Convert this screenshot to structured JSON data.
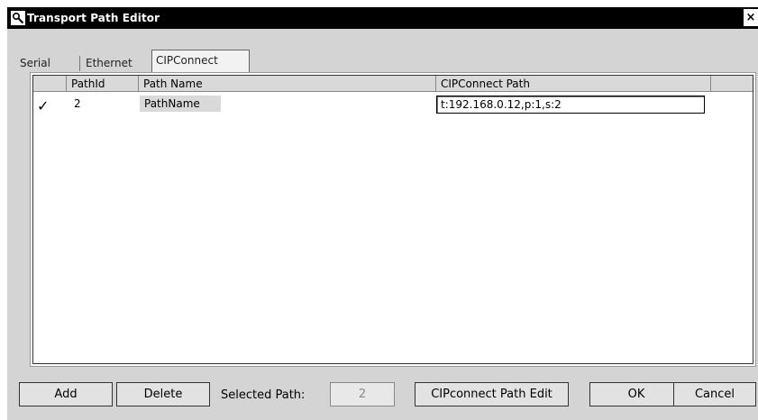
{
  "window": {
    "title": "Transport Path Editor",
    "close_glyph": "×"
  },
  "tabs": [
    {
      "label": "Serial"
    },
    {
      "label": "Ethernet"
    },
    {
      "label": "CIPConnect"
    }
  ],
  "grid": {
    "columns": [
      "",
      "PathId",
      "Path Name",
      "CIPConnect Path"
    ],
    "rows": [
      {
        "checked": "✓",
        "path_id": "2",
        "path_name": "PathName",
        "cip_path": "t:192.168.0.12,p:1,s:2"
      }
    ]
  },
  "footer": {
    "add_label": "Add",
    "delete_label": "Delete",
    "selected_path_label": "Selected Path:",
    "selected_path_value": "2",
    "cip_edit_label": "CIPconnect Path Edit",
    "ok_label": "OK",
    "cancel_label": "Cancel"
  }
}
